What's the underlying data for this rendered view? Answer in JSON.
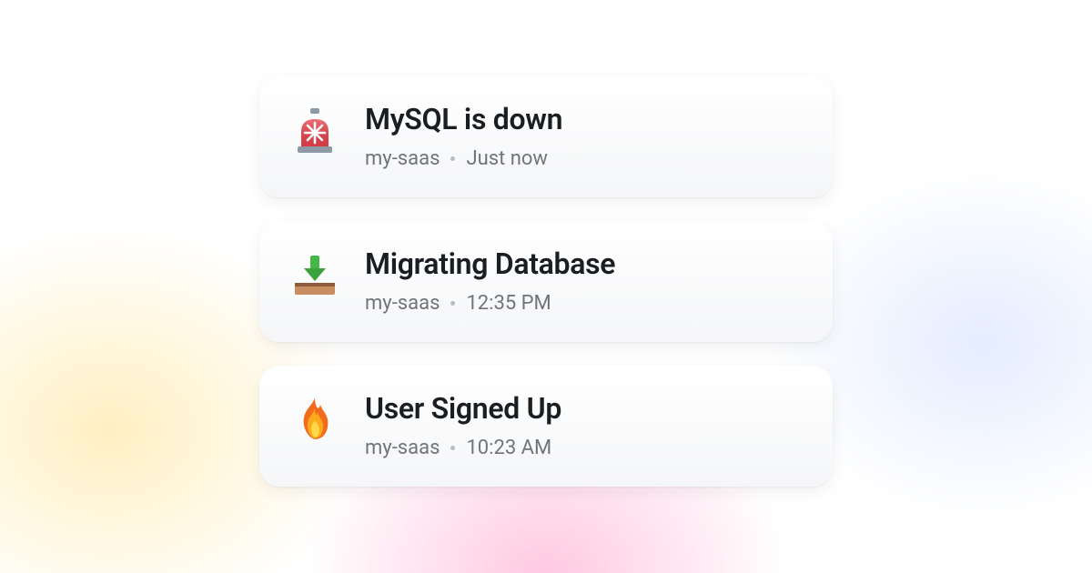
{
  "notifications": [
    {
      "icon": "siren-icon",
      "title": "MySQL is down",
      "project": "my-saas",
      "time": "Just now"
    },
    {
      "icon": "inbox-download-icon",
      "title": "Migrating Database",
      "project": "my-saas",
      "time": "12:35 PM"
    },
    {
      "icon": "fire-icon",
      "title": "User Signed Up",
      "project": "my-saas",
      "time": "10:23 AM"
    }
  ]
}
